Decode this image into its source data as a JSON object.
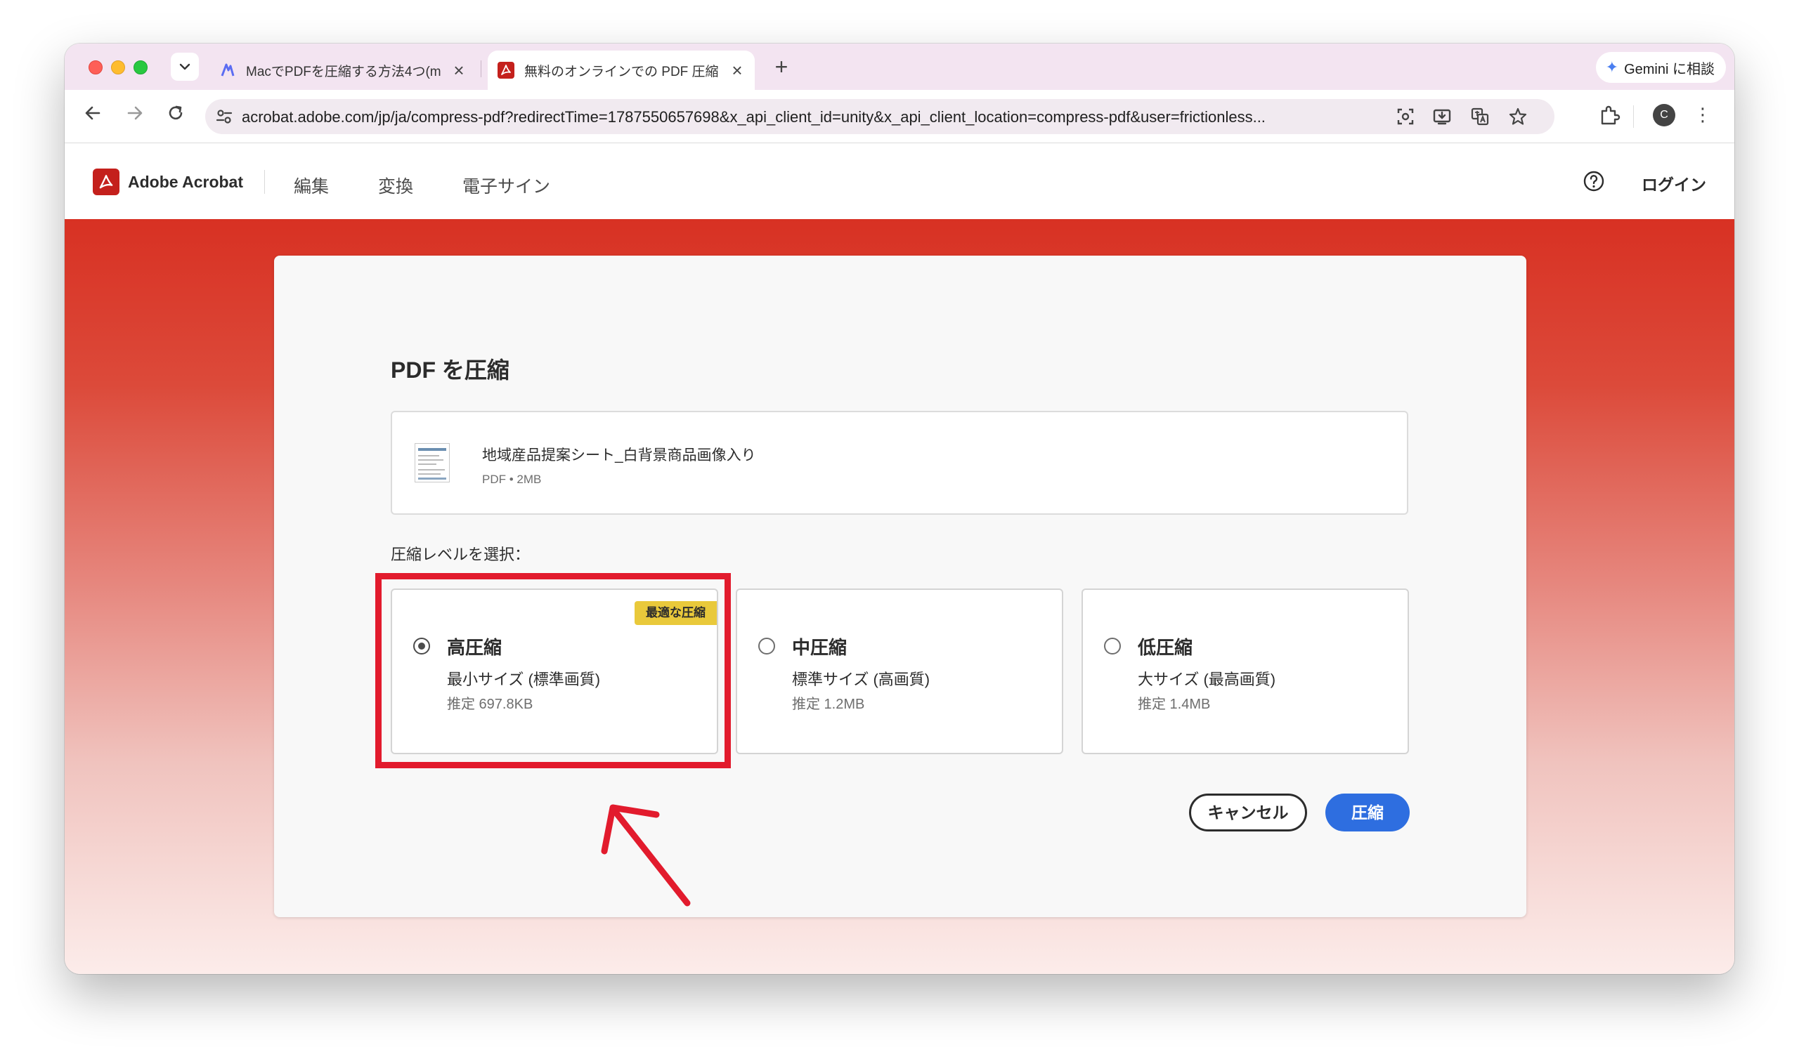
{
  "browser": {
    "tabs": [
      {
        "title": "MacでPDFを圧縮する方法4つ(m",
        "favicon": "mac-help-favicon"
      },
      {
        "title": "無料のオンラインでの PDF 圧縮",
        "favicon": "acrobat-favicon",
        "active": true
      }
    ],
    "new_tab_symbol": "+",
    "close_symbol": "×",
    "gemini_label": "Gemini に相談",
    "url": "acrobat.adobe.com/jp/ja/compress-pdf?redirectTime=1787550657698&x_api_client_id=unity&x_api_client_location=compress-pdf&user=frictionless...",
    "profile_initial": "C"
  },
  "site": {
    "brand": "Adobe Acrobat",
    "nav": [
      "編集",
      "変換",
      "電子サイン"
    ],
    "login": "ログイン"
  },
  "dialog": {
    "title": "PDF を圧縮",
    "file": {
      "name": "地域産品提案シート_白背景商品画像入り",
      "meta": "PDF • 2MB"
    },
    "level_label": "圧縮レベルを選択：",
    "options": [
      {
        "title": "高圧縮",
        "desc": "最小サイズ (標準画質)",
        "estimate": "推定 697.8KB",
        "badge": "最適な圧縮",
        "selected": true
      },
      {
        "title": "中圧縮",
        "desc": "標準サイズ (高画質)",
        "estimate": "推定 1.2MB",
        "selected": false
      },
      {
        "title": "低圧縮",
        "desc": "大サイズ (最高画質)",
        "estimate": "推定 1.4MB",
        "selected": false
      }
    ],
    "cancel_label": "キャンセル",
    "compress_label": "圧縮"
  },
  "colors": {
    "accent_red": "#d83123",
    "primary_blue": "#2e6ee0",
    "badge_yellow": "#e9c93b",
    "annotation_red": "#e21b2d"
  }
}
